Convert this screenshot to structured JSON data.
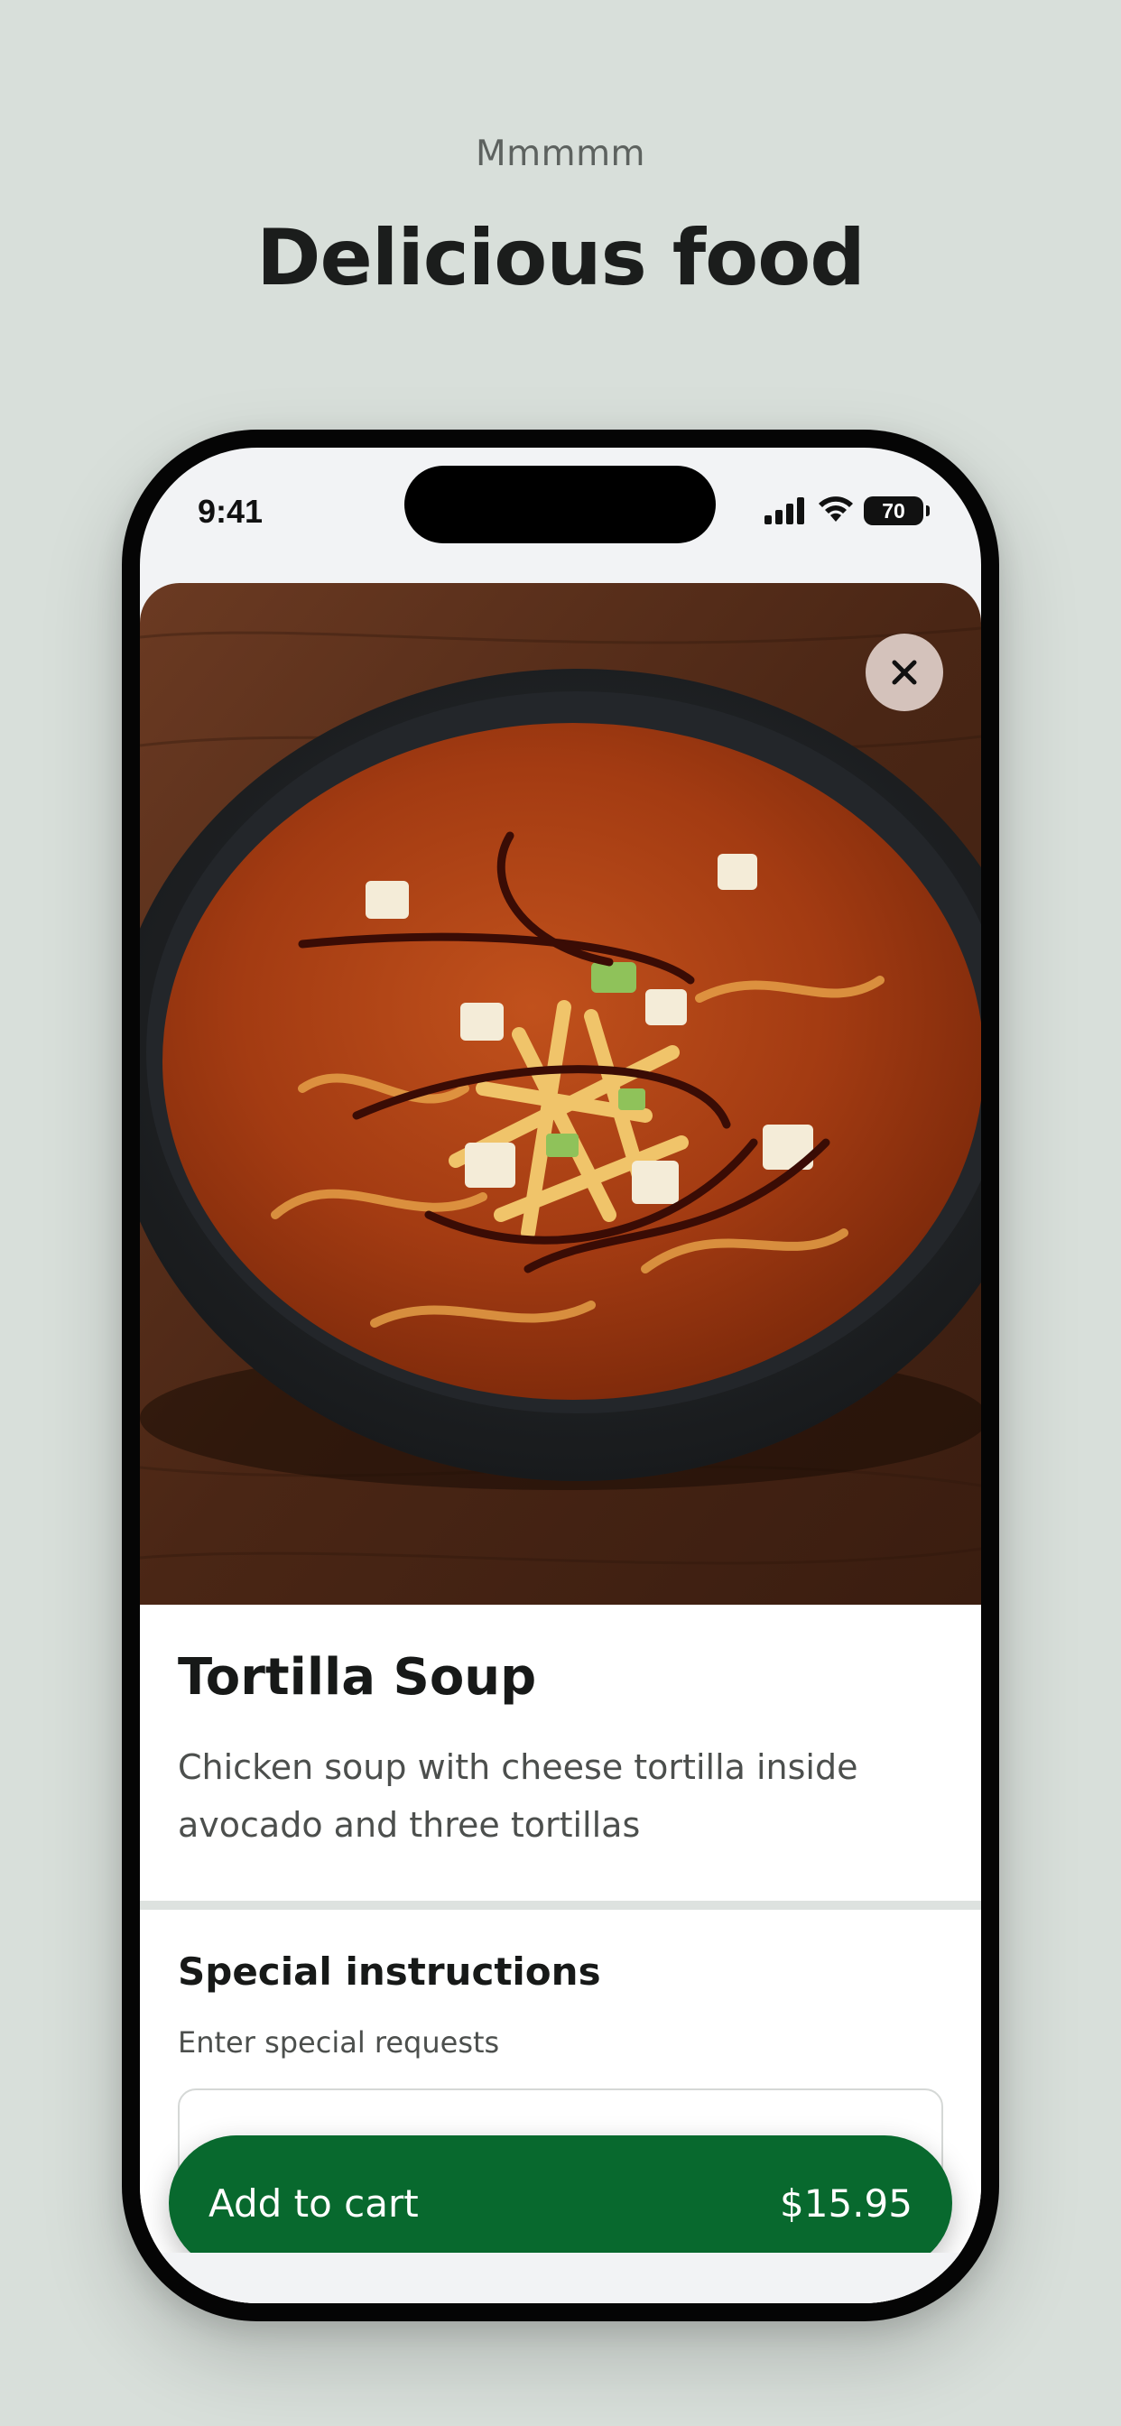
{
  "header": {
    "eyebrow": "Mmmmm",
    "title": "Delicious food"
  },
  "status_bar": {
    "time": "9:41",
    "battery": "70",
    "icons": [
      "signal-icon",
      "wifi-icon",
      "battery-icon"
    ]
  },
  "item": {
    "image_alt": "Bowl of tortilla soup",
    "close_icon": "close-icon",
    "title": "Tortilla Soup",
    "description": "Chicken soup with cheese tortilla inside avocado and three tortillas"
  },
  "special_instructions": {
    "title": "Special instructions",
    "subtitle": "Enter special requests"
  },
  "cart_button": {
    "label": "Add to cart",
    "price": "$15.95"
  },
  "colors": {
    "background": "#d8dfda",
    "accent_green": "#08692e",
    "phone_frame": "#050505",
    "text_primary": "#171918",
    "text_secondary": "#4c4f4d"
  }
}
